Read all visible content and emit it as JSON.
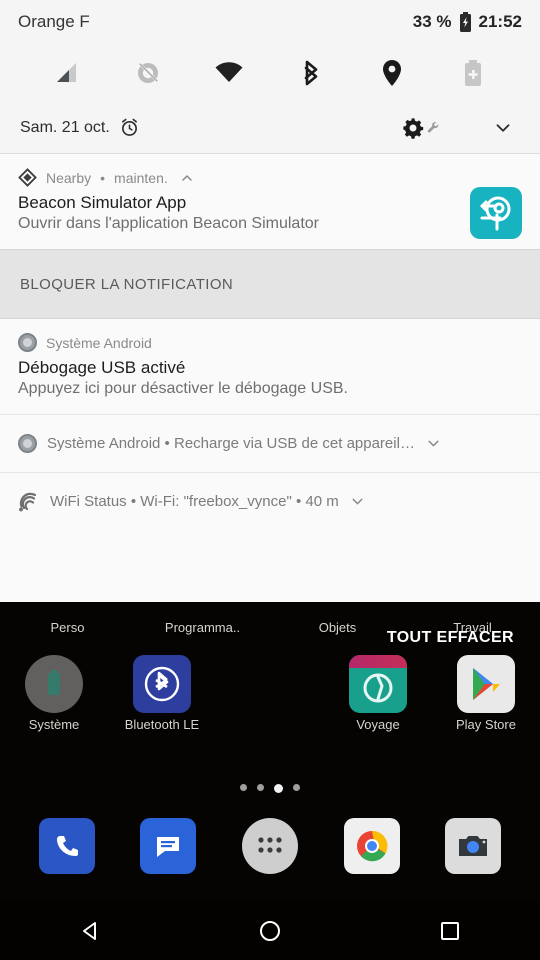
{
  "status_bar": {
    "carrier": "Orange F",
    "battery_percent": "33 %",
    "battery_icon": "battery-charging-icon",
    "clock": "21:52"
  },
  "quick_status_icons": [
    {
      "name": "cellular-signal-icon",
      "label": "Signal mobile"
    },
    {
      "name": "sync-disabled-icon",
      "label": "Synchronisation desactivee"
    },
    {
      "name": "wifi-icon",
      "label": "Wi-Fi"
    },
    {
      "name": "bluetooth-icon",
      "label": "Bluetooth"
    },
    {
      "name": "location-icon",
      "label": "Localisation"
    },
    {
      "name": "battery-saver-icon",
      "label": "Economiseur de batterie"
    }
  ],
  "date_row": {
    "date": "Sam. 21 oct.",
    "alarm_icon": "alarm-clock-icon",
    "settings_icon": "gear-icon",
    "tuner_icon": "wrench-icon",
    "expand_icon": "chevron-down-icon"
  },
  "notifications": [
    {
      "id": "nearby",
      "app": "Nearby",
      "separator": "•",
      "time": "mainten.",
      "collapse_icon": "chevron-up-icon",
      "app_icon": "nearby-diamond-icon",
      "title": "Beacon Simulator App",
      "text": "Ouvrir dans l'application Beacon Simulator",
      "big_icon": "beacon-simulator-app-icon",
      "big_icon_color": "#17b3c0"
    },
    {
      "id": "usb-debug",
      "app": "Système Android",
      "app_icon": "android-system-icon",
      "title": "Débogage USB activé",
      "text": "Appuyez ici pour désactiver le débogage USB."
    }
  ],
  "block_banner": {
    "label": "BLOQUER LA NOTIFICATION"
  },
  "collapsed_notifications": [
    {
      "id": "usb-charge",
      "app_icon": "android-system-icon",
      "line": "Système Android • Recharge via USB de cet appareil…",
      "expand_icon": "chevron-down-icon"
    },
    {
      "id": "wifi-status",
      "app_icon": "wifi-status-icon",
      "line": "WiFi Status • Wi-Fi: \"freebox_vynce\" • 40 m",
      "expand_icon": "chevron-down-icon"
    }
  ],
  "clear_all": {
    "label": "TOUT EFFACER"
  },
  "home_screen": {
    "folders": [
      {
        "label": "Perso",
        "icon": "folder-icon"
      },
      {
        "label": "Programma..",
        "icon": "folder-icon"
      },
      {
        "label": "Objets",
        "icon": "folder-icon"
      },
      {
        "label": "Travail",
        "icon": "folder-icon"
      }
    ],
    "apps": [
      {
        "label": "Système",
        "icon": "system-folder-icon"
      },
      {
        "label": "Bluetooth LE",
        "icon": "bluetooth-le-app-icon"
      },
      {
        "label": "",
        "icon": ""
      },
      {
        "label": "Voyage",
        "icon": "voyage-folder-icon"
      },
      {
        "label": "Play Store",
        "icon": "play-store-icon"
      }
    ],
    "page_dots": {
      "count": 4,
      "active_index": 2
    },
    "dock": [
      {
        "label": "Phone",
        "icon": "phone-icon"
      },
      {
        "label": "Messages",
        "icon": "messages-icon"
      },
      {
        "label": "Apps",
        "icon": "app-drawer-icon"
      },
      {
        "label": "Chrome",
        "icon": "chrome-icon"
      },
      {
        "label": "Camera",
        "icon": "camera-icon"
      }
    ]
  },
  "nav_bar": [
    {
      "name": "back-button",
      "icon": "back-triangle-icon"
    },
    {
      "name": "home-button",
      "icon": "home-circle-icon"
    },
    {
      "name": "recents-button",
      "icon": "recents-square-icon"
    }
  ],
  "colors": {
    "panel_bg": "#fafafa",
    "status_bg": "#f5f5f5",
    "banner_bg": "#e4e4e4",
    "accent_teal": "#17b3c0"
  }
}
